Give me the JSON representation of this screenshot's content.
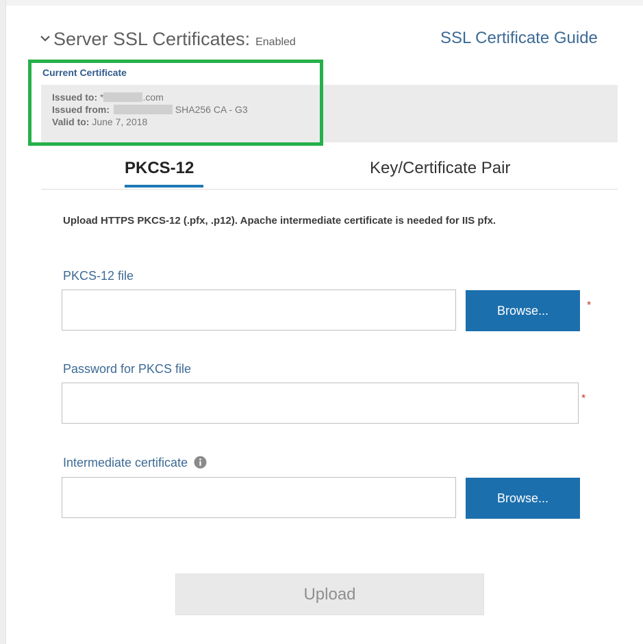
{
  "header": {
    "title": "Server SSL Certificates:",
    "status": "Enabled",
    "guide_link": "SSL Certificate Guide"
  },
  "current_certificate": {
    "heading": "Current Certificate",
    "issued_to_label": "Issued to:",
    "issued_to_prefix": "*",
    "issued_to_suffix": ".com",
    "issued_from_label": "Issued from:",
    "issued_from_value": "SHA256 CA - G3",
    "valid_to_label": "Valid to:",
    "valid_to_value": "June 7, 2018"
  },
  "tabs": [
    {
      "label": "PKCS-12",
      "active": true
    },
    {
      "label": "Key/Certificate Pair",
      "active": false
    }
  ],
  "form": {
    "instructions": "Upload HTTPS PKCS-12 (.pfx, .p12). Apache intermediate certificate is needed for IIS pfx.",
    "pkcs_file_label": "PKCS-12 file",
    "password_label": "Password for PKCS file",
    "intermediate_label": "Intermediate certificate",
    "browse_label": "Browse...",
    "required_marker": "*",
    "upload_label": "Upload"
  },
  "colors": {
    "accent": "#1c6fad",
    "link": "#3d6a95",
    "highlight_border": "#26b04b",
    "required": "#c0392b"
  },
  "icons": {
    "collapse": "chevron-down-icon",
    "info": "info-icon"
  }
}
